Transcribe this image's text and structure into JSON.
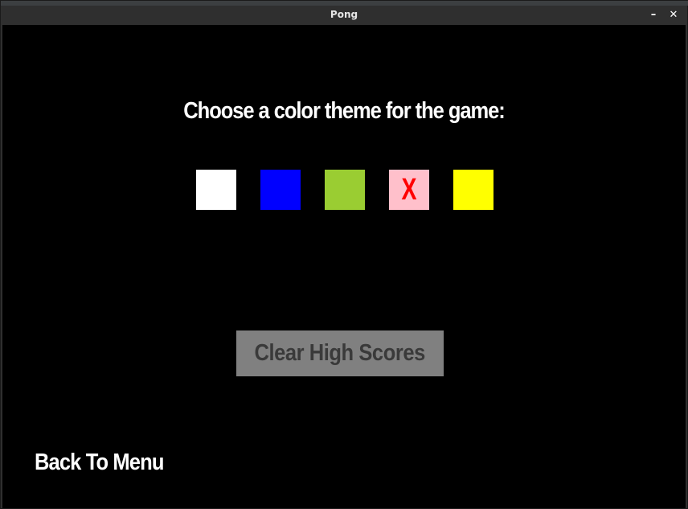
{
  "window": {
    "title": "Pong",
    "minimize_glyph": "–",
    "close_glyph": "✕"
  },
  "theme_picker": {
    "heading": "Choose a color theme for the game:",
    "swatches": [
      {
        "color": "#ffffff",
        "mark": "",
        "selected": false
      },
      {
        "color": "#0000ff",
        "mark": "",
        "selected": false
      },
      {
        "color": "#9acd32",
        "mark": "",
        "selected": false
      },
      {
        "color": "#ffc0cb",
        "mark": "X",
        "mark_color": "#ff0000",
        "selected": true
      },
      {
        "color": "#ffff00",
        "mark": "",
        "selected": false
      }
    ]
  },
  "clear_button": {
    "label": "Clear High Scores"
  },
  "back_link": {
    "label": "Back To Menu"
  }
}
